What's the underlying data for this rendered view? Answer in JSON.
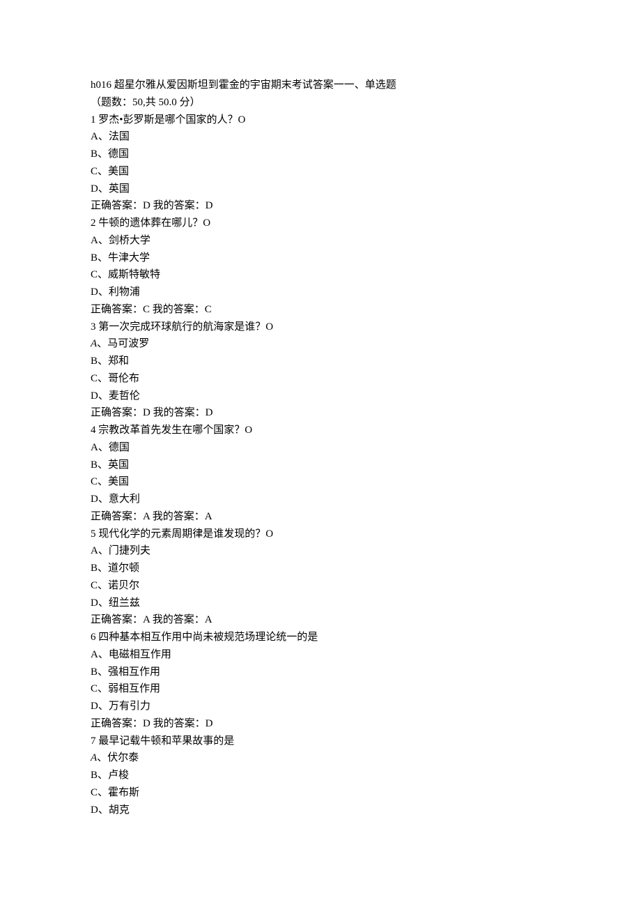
{
  "header_line": "h016 超星尔雅从爱因斯坦到霍金的宇宙期末考试答案一一、单选题",
  "count_line": "（题数：50,共 50.0 分）",
  "questions": [
    {
      "num": "1",
      "stem": "罗杰•彭罗斯是哪个国家的人？O",
      "opts": {
        "A": "法国",
        "B": "德国",
        "C": "美国",
        "D": "英国"
      },
      "correct": "D",
      "my": "D"
    },
    {
      "num": "2",
      "stem": "牛顿的遗体葬在哪儿？O",
      "opts": {
        "A": "剑桥大学",
        "B": "牛津大学",
        "C": "威斯特敏特",
        "D": "利物浦"
      },
      "correct": "C",
      "my": "C"
    },
    {
      "num": "3",
      "stem": "第一次完成环球航行的航海家是谁？O",
      "opts": {
        "A": "马可波罗",
        "B": "郑和",
        "C": "哥伦布",
        "D": "麦哲伦"
      },
      "a_italic": true,
      "correct": "D",
      "my": "D"
    },
    {
      "num": "4",
      "stem": "宗教改革首先发生在哪个国家？O",
      "opts": {
        "A": "德国",
        "B": "英国",
        "C": "美国",
        "D": "意大利"
      },
      "correct": "A",
      "my": "A"
    },
    {
      "num": "5",
      "stem": "现代化学的元素周期律是谁发现的？O",
      "opts": {
        "A": "门捷列夫",
        "B": "道尔顿",
        "C": "诺贝尔",
        "D": "纽兰兹"
      },
      "correct": "A",
      "my": "A"
    },
    {
      "num": "6",
      "stem": "四种基本相互作用中尚未被规范场理论统一的是",
      "opts": {
        "A": "电磁相互作用",
        "B": "强相互作用",
        "C": "弱相互作用",
        "D": "万有引力"
      },
      "correct": "D",
      "my": "D"
    },
    {
      "num": "7",
      "stem": "最早记载牛顿和苹果故事的是",
      "opts": {
        "A": "伏尔泰",
        "B": "卢梭",
        "C": "霍布斯",
        "D": "胡克"
      },
      "a_italic": true
    }
  ],
  "labels": {
    "correct_prefix": "正确答案：",
    "my_prefix": " 我的答案：",
    "opt_sep": "、"
  }
}
